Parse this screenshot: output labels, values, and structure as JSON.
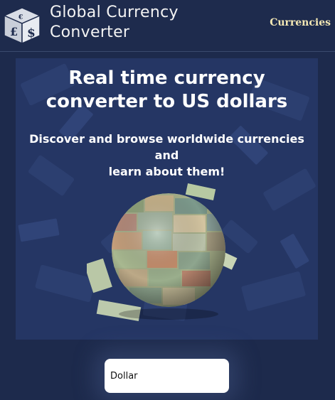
{
  "header": {
    "brand_line1": "Global Currency",
    "brand_line2": "Converter",
    "nav_link": "Currencies"
  },
  "hero": {
    "title_line1": "Real time currency",
    "title_line2": "converter to US dollars",
    "subtitle_line1": "Discover and browse worldwide currencies and",
    "subtitle_line2": "learn about them!"
  },
  "search": {
    "value": "Dollar"
  },
  "colors": {
    "page_background": "#1d2a4c",
    "hero_background": "#253664",
    "nav_link": "#f3e7b4"
  },
  "icons": {
    "logo": "currency-dice-icon",
    "hero_image": "money-globe-icon"
  }
}
